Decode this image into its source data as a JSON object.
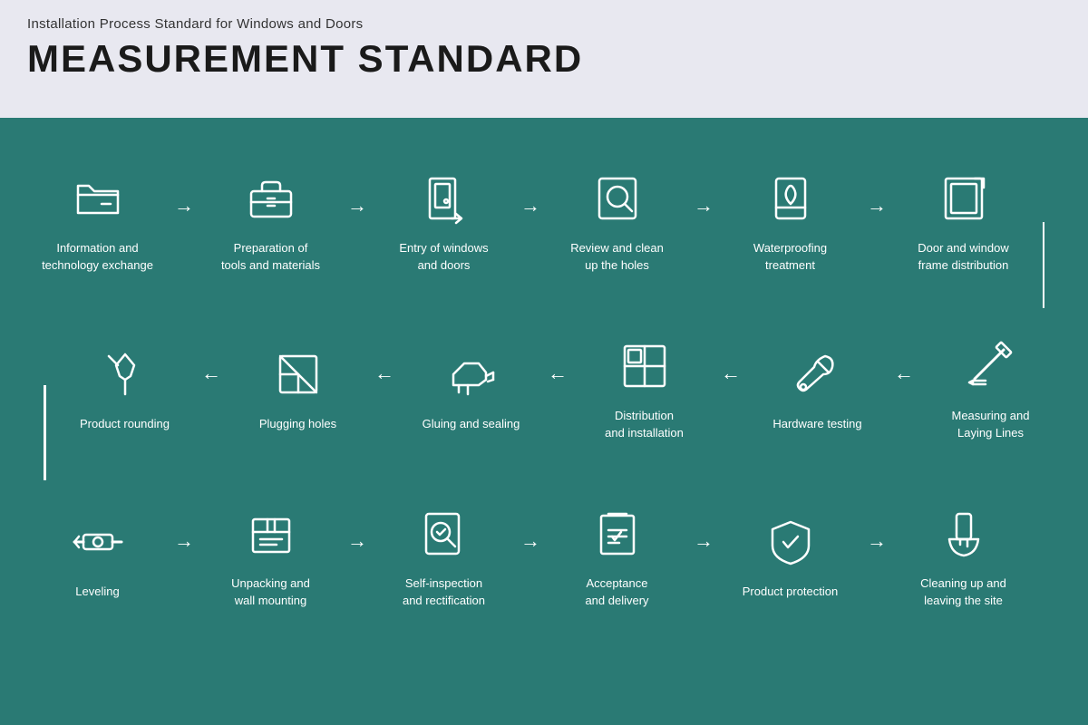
{
  "header": {
    "subtitle": "Installation Process Standard for Windows and Doors",
    "title": "MEASUREMENT STANDARD"
  },
  "row1": [
    {
      "id": "info-tech",
      "label": "Information and\ntechnology exchange",
      "icon": "folder"
    },
    {
      "id": "tools-prep",
      "label": "Preparation of\ntools and materials",
      "icon": "toolbox"
    },
    {
      "id": "entry-windows",
      "label": "Entry of windows\nand doors",
      "icon": "door-entry"
    },
    {
      "id": "review-holes",
      "label": "Review and clean\nup the holes",
      "icon": "magnifier"
    },
    {
      "id": "waterproofing",
      "label": "Waterproofing\ntreatment",
      "icon": "waterproof"
    },
    {
      "id": "frame-dist",
      "label": "Door and window\nframe distribution",
      "icon": "frame"
    }
  ],
  "row2": [
    {
      "id": "measuring",
      "label": "Measuring and\nLaying Lines",
      "icon": "pencil-ruler"
    },
    {
      "id": "hardware",
      "label": "Hardware testing",
      "icon": "wrench"
    },
    {
      "id": "distribution",
      "label": "Distribution\nand installation",
      "icon": "grid-panel"
    },
    {
      "id": "gluing",
      "label": "Gluing and sealing",
      "icon": "glue-gun"
    },
    {
      "id": "plugging",
      "label": "Plugging holes",
      "icon": "square-corner"
    },
    {
      "id": "rounding",
      "label": "Product rounding",
      "icon": "pin"
    }
  ],
  "row3": [
    {
      "id": "leveling",
      "label": "Leveling",
      "icon": "level"
    },
    {
      "id": "unpacking",
      "label": "Unpacking and\nwall mounting",
      "icon": "package"
    },
    {
      "id": "self-inspect",
      "label": "Self-inspection\nand rectification",
      "icon": "magnifier-check"
    },
    {
      "id": "acceptance",
      "label": "Acceptance\nand delivery",
      "icon": "clipboard-check"
    },
    {
      "id": "protection",
      "label": "Product protection",
      "icon": "shield-check"
    },
    {
      "id": "cleanup",
      "label": "Cleaning up and\nleaving the site",
      "icon": "broom"
    }
  ]
}
